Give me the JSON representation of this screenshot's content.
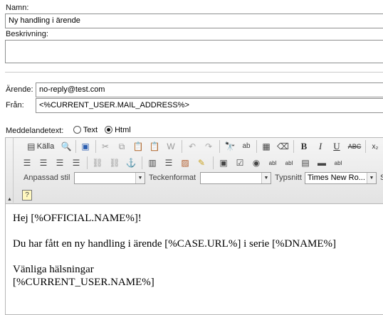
{
  "form": {
    "name_label": "Namn:",
    "name_value": "Ny handling i ärende",
    "description_label": "Beskrivning:",
    "description_value": "",
    "subject_label": "Ärende:",
    "subject_value": "no-reply@test.com",
    "from_label": "Från:",
    "from_value": "<%CURRENT_USER.MAIL_ADDRESS%>",
    "message_text_label": "Meddelandetext:",
    "format_options": [
      {
        "label": "Text",
        "selected": false
      },
      {
        "label": "Html",
        "selected": true
      }
    ]
  },
  "toolbar": {
    "source_label": "Källa",
    "style_label": "Anpassad stil",
    "style_value": "",
    "format_label": "Teckenformat",
    "format_value": "",
    "font_label": "Typsnitt",
    "font_value": "Times New Ro...",
    "size_label_partial": "S"
  },
  "editor": {
    "lines": [
      "Hej [%OFFICIAL.NAME%]!",
      "Du har fått en ny handling i ärende [%CASE.URL%] i serie [%DNAME%]",
      "Vänliga hälsningar",
      "[%CURRENT_USER.NAME%]"
    ]
  }
}
